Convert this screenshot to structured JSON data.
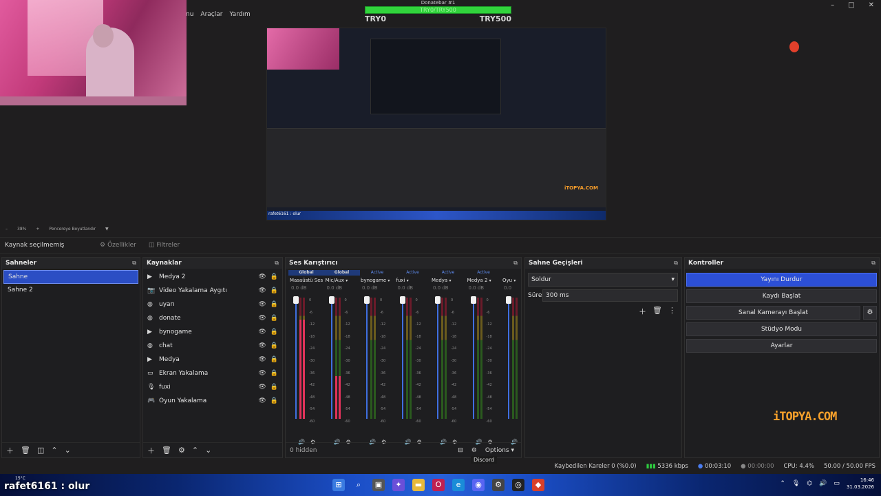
{
  "menu": [
    "nu",
    "Araçlar",
    "Yardım"
  ],
  "window_controls": [
    "–",
    "□",
    "✕"
  ],
  "donate": {
    "title": "Donatebar #1",
    "bar_text": "TRY0/TRY500",
    "left": "TRY0",
    "right": "TRY500",
    "progress": 1.0,
    "bar_color": "#31d33c"
  },
  "preview": {
    "caption": "rafet6161 : olur",
    "logo": "iTOPYA.COM"
  },
  "zoom": {
    "minus": "–",
    "value": "38%",
    "plus": "+",
    "fit": "Pencereye Boyutlandır"
  },
  "source_bar": {
    "label": "Kaynak seçilmemiş",
    "props": "Özellikler",
    "filters": "Filtreler"
  },
  "scenes": {
    "title": "Sahneler",
    "items": [
      "Sahne",
      "Sahne 2"
    ]
  },
  "sources": {
    "title": "Kaynaklar",
    "items": [
      {
        "icon": "play-icon",
        "glyph": "▶",
        "name": "Medya 2"
      },
      {
        "icon": "camera-icon",
        "glyph": "📷",
        "name": "Video Yakalama Aygıtı"
      },
      {
        "icon": "globe-icon",
        "glyph": "◍",
        "name": "uyarı"
      },
      {
        "icon": "globe-icon",
        "glyph": "◍",
        "name": "donate"
      },
      {
        "icon": "play-icon",
        "glyph": "▶",
        "name": "bynogame"
      },
      {
        "icon": "globe-icon",
        "glyph": "◍",
        "name": "chat"
      },
      {
        "icon": "play-icon",
        "glyph": "▶",
        "name": "Medya"
      },
      {
        "icon": "monitor-icon",
        "glyph": "▭",
        "name": "Ekran Yakalama"
      },
      {
        "icon": "microphone-icon",
        "glyph": "🎙",
        "name": "fuxi"
      },
      {
        "icon": "gamepad-icon",
        "glyph": "🎮",
        "name": "Oyun Yakalama"
      }
    ]
  },
  "mixer": {
    "title": "Ses Karıştırıcı",
    "hidden": "0 hidden",
    "options": "Options",
    "ticks": [
      "0",
      "-6",
      "-12",
      "-18",
      "-24",
      "-30",
      "-36",
      "-42",
      "-48",
      "-54",
      "-60"
    ],
    "channels": [
      {
        "tag": "Global",
        "name": "Masaüstü Ses",
        "db": "0.0 dB",
        "level": 0.82
      },
      {
        "tag": "Global",
        "name": "Mic/Aux",
        "db": "0.0 dB",
        "level": 0.35
      },
      {
        "tag": "Active",
        "name": "bynogame",
        "db": "0.0 dB",
        "level": 0.0
      },
      {
        "tag": "Active",
        "name": "fuxi",
        "db": "0.0 dB",
        "level": 0.0
      },
      {
        "tag": "Active",
        "name": "Medya",
        "db": "0.0 dB",
        "level": 0.0
      },
      {
        "tag": "Active",
        "name": "Medya 2",
        "db": "0.0 dB",
        "level": 0.0
      },
      {
        "tag": "",
        "name": "Oyu",
        "db": "0.0",
        "level": 0.0
      }
    ]
  },
  "transitions": {
    "title": "Sahne Geçişleri",
    "selected": "Soldur",
    "duration_label": "Süre",
    "duration": "300 ms"
  },
  "controls": {
    "title": "Kontroller",
    "buttons": [
      "Yayını Durdur",
      "Kaydı Başlat",
      "Sanal Kamerayı Başlat",
      "Stüdyo Modu",
      "Ayarlar"
    ]
  },
  "watermark": "iTOPYA.COM",
  "tooltip": "Discord",
  "status": {
    "dropped": "Kaybedilen Kareler 0 (%0.0)",
    "bitrate": "5336 kbps",
    "live": "00:03:10",
    "rec": "00:00:00",
    "cpu": "CPU: 4.4%",
    "fps": "50.00 / 50.00 FPS"
  },
  "taskbar": {
    "caption": "rafet6161 : olur",
    "weather": "15°C",
    "time": "16:46",
    "date": "31.03.2026"
  },
  "colors": {
    "accent": "#2c4fd6",
    "selection": "#2b4ec4",
    "logo": "#f7a12b"
  }
}
